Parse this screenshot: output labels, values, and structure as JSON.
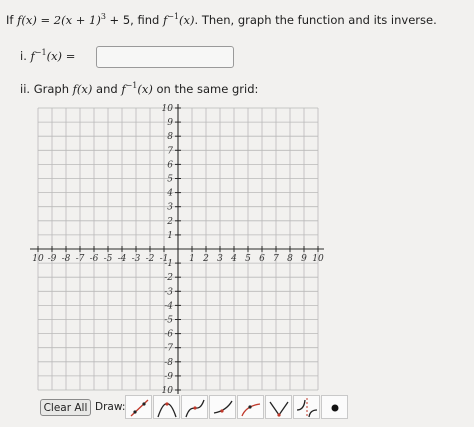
{
  "question": {
    "intro": "If",
    "function": "f(x) = 2(x + 1)",
    "exponent": "3",
    "function_tail": " + 5, find",
    "inverse": "f",
    "inverse_exp": "−1",
    "inverse_arg": "(x)",
    "rest": ". Then, graph the function and its inverse."
  },
  "part_i": {
    "label": "i.",
    "expr": "f",
    "expr_exp": "−1",
    "expr_tail": "(x) =",
    "answer_value": ""
  },
  "part_ii": {
    "label": "ii. Graph",
    "f": "f(x)",
    "and": "and",
    "finv": "f",
    "finv_exp": "−1",
    "finv_tail": "(x)",
    "rest": "on the same grid:"
  },
  "grid": {
    "x_min": -10,
    "x_max": 10,
    "y_min": -10,
    "y_max": 10,
    "x_tick_labels": [
      "10",
      "-9",
      "-8",
      "-7",
      "-6",
      "-5",
      "-4",
      "-3",
      "-2",
      "-1",
      "1",
      "2",
      "3",
      "4",
      "5",
      "6",
      "7",
      "8",
      "9",
      "10"
    ],
    "y_tick_labels": [
      "10",
      "9",
      "8",
      "7",
      "6",
      "5",
      "4",
      "3",
      "2",
      "1",
      "-1",
      "-2",
      "-3",
      "-4",
      "-5",
      "-6",
      "-7",
      "-8",
      "-9",
      "10"
    ],
    "grid_color": "#b9b9b9",
    "axis_color": "#2a2a2a"
  },
  "toolbar": {
    "clear_label": "Clear All",
    "draw_label": "Draw:",
    "tools": [
      "line-tool-icon",
      "parabola-tool-icon",
      "cubic-tool-icon",
      "exponential-tool-icon",
      "logarithm-tool-icon",
      "absolute-value-tool-icon",
      "rational-tool-icon",
      "point-tool-icon"
    ],
    "tool_color": "#c0392b"
  }
}
